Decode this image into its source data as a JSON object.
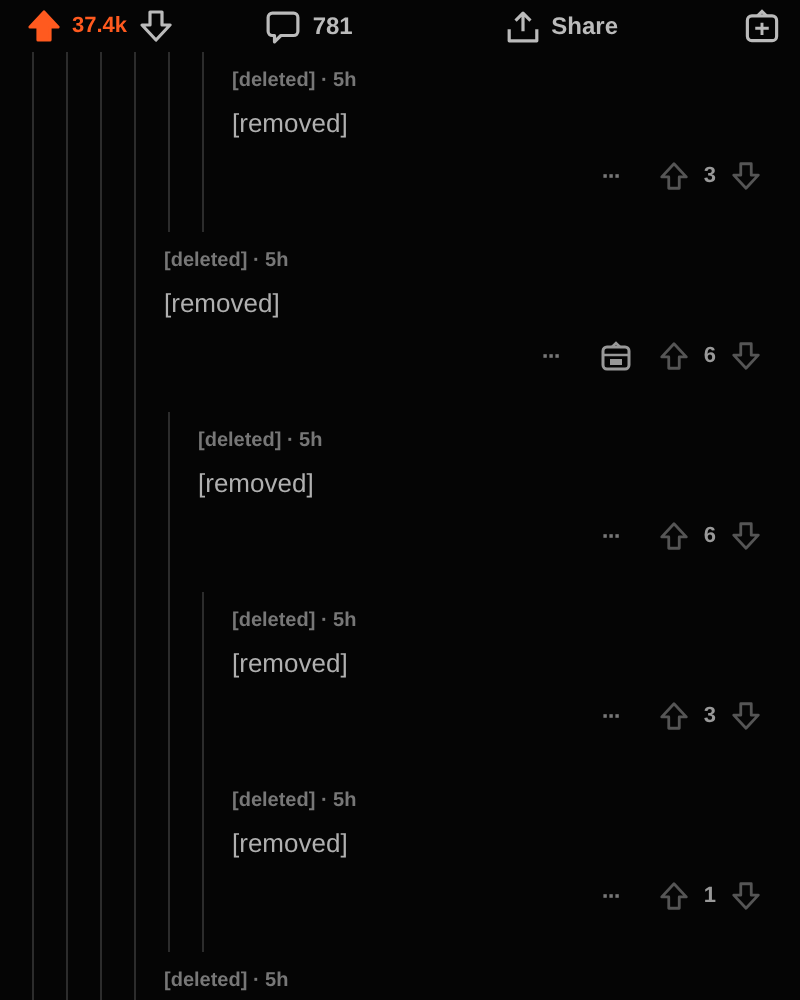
{
  "post_actions": {
    "upvoted": true,
    "score": "37.4k",
    "comments": "781",
    "share": "Share"
  },
  "reply_above": {
    "meta": "[deleted] · 5h",
    "body": "[removed]",
    "more": "···",
    "score": "3",
    "award": false
  },
  "comments": [
    {
      "meta": "[deleted] · 5h",
      "body": "[removed]",
      "more": "···",
      "score": "6",
      "award": true,
      "children": [
        {
          "meta": "[deleted] · 5h",
          "body": "[removed]",
          "more": "···",
          "score": "6",
          "award": false,
          "children": [
            {
              "meta": "[deleted] · 5h",
              "body": "[removed]",
              "more": "···",
              "score": "3",
              "award": false
            },
            {
              "meta": "[deleted] · 5h",
              "body": "[removed]",
              "more": "···",
              "score": "1",
              "award": false
            }
          ]
        }
      ]
    },
    {
      "meta": "[deleted] · 5h"
    }
  ]
}
